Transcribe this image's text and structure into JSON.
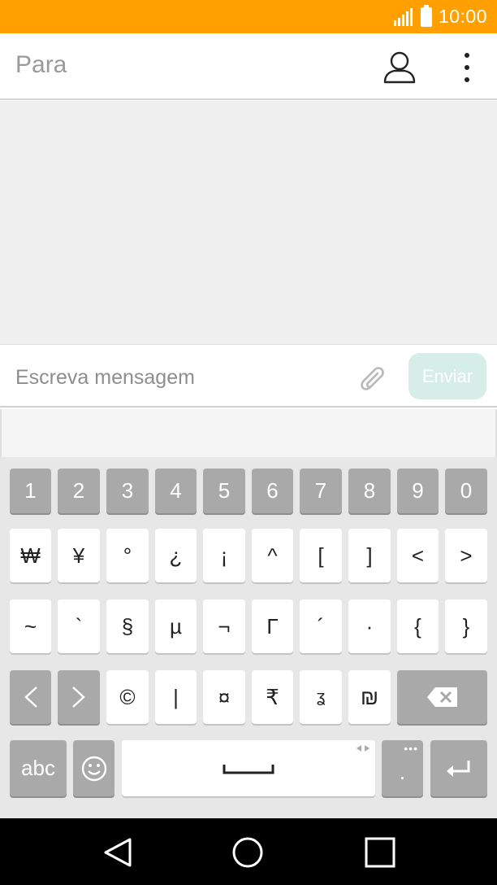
{
  "status_bar": {
    "time": "10:00",
    "signal_icon": "signal-icon",
    "battery_icon": "battery-icon",
    "background": "#ffa000"
  },
  "recipient_bar": {
    "placeholder": "Para",
    "contact_icon": "person-icon",
    "menu_icon": "more-vert-icon"
  },
  "compose": {
    "placeholder": "Escreva mensagem",
    "attach_icon": "paperclip-icon",
    "send_label": "Enviar",
    "send_color": "#d6ede8"
  },
  "keyboard": {
    "row1": [
      "1",
      "2",
      "3",
      "4",
      "5",
      "6",
      "7",
      "8",
      "9",
      "0"
    ],
    "row2": [
      "₩",
      "¥",
      "°",
      "¿",
      "¡",
      "^",
      "[",
      "]",
      "<",
      ">"
    ],
    "row3": [
      "~",
      "`",
      "§",
      "µ",
      "¬",
      "Γ",
      "´",
      "·",
      "{",
      "}"
    ],
    "row4_keys": [
      "©",
      "|",
      "¤",
      "₹",
      "ʓ",
      "₪"
    ],
    "prev_icon": "chevron-left-icon",
    "next_icon": "chevron-right-icon",
    "backspace_icon": "backspace-icon",
    "abc_label": "abc",
    "emoji_icon": "smiley-icon",
    "space_icon": "space-bar-icon",
    "period_label": ".",
    "enter_icon": "enter-icon"
  },
  "nav_bar": {
    "back_icon": "back-triangle-icon",
    "home_icon": "home-circle-icon",
    "recents_icon": "recents-square-icon"
  }
}
